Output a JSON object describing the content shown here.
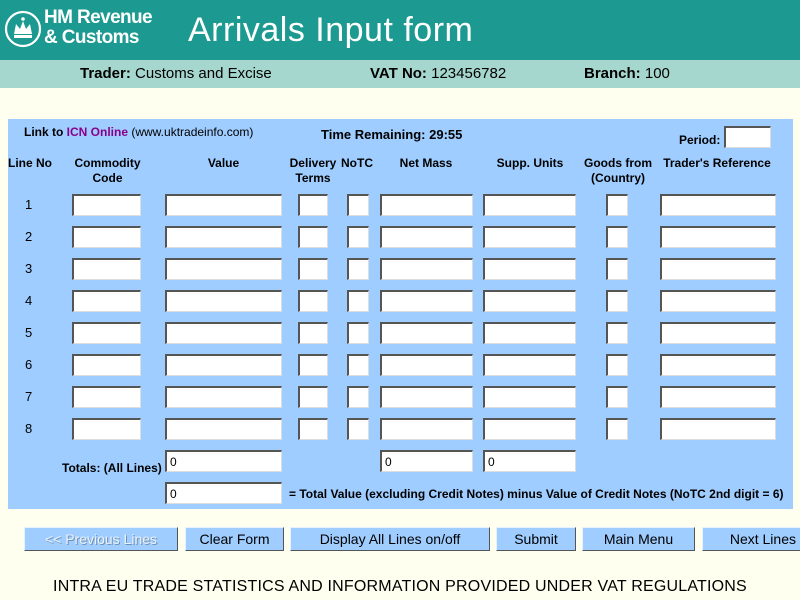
{
  "header": {
    "logo_line1": "HM Revenue",
    "logo_line2": "& Customs",
    "title": "Arrivals Input form",
    "bg_color": "#1C9A91"
  },
  "subbar": {
    "trader_label": "Trader:",
    "trader_value": "Customs and Excise",
    "vat_label": "VAT No:",
    "vat_value": "123456782",
    "branch_label": "Branch:",
    "branch_value": "100"
  },
  "form": {
    "link_prefix": "Link to ",
    "link_text": "ICN Online",
    "link_suffix": " (www.uktradeinfo.com)",
    "time_remaining": "Time Remaining: 29:55",
    "period_label": "Period:",
    "period_value": "",
    "columns": {
      "line_no": "Line No",
      "commodity_1": "Commodity",
      "commodity_2": "Code",
      "value": "Value",
      "delivery_1": "Delivery",
      "delivery_2": "Terms",
      "notc": "NoTC",
      "net_mass": "Net Mass",
      "supp_units": "Supp. Units",
      "goods_1": "Goods from",
      "goods_2": "(Country)",
      "traders_ref": "Trader's Reference"
    },
    "lines": [
      "1",
      "2",
      "3",
      "4",
      "5",
      "6",
      "7",
      "8"
    ],
    "totals_label": "Totals: (All Lines)",
    "total_value": "0",
    "total_net_mass": "0",
    "total_supp_units": "0",
    "net_total_value": "0",
    "net_total_note": "= Total Value (excluding Credit Notes) minus Value of Credit Notes (NoTC 2nd digit = 6)",
    "panel_color": "#9FCDFF"
  },
  "buttons": {
    "previous": "<< Previous Lines",
    "clear": "Clear Form",
    "display_all": "Display All Lines on/off",
    "submit": "Submit",
    "main_menu": "Main Menu",
    "next": "Next Lines"
  },
  "footer": {
    "text": "INTRA EU TRADE STATISTICS AND INFORMATION PROVIDED UNDER VAT REGULATIONS"
  }
}
